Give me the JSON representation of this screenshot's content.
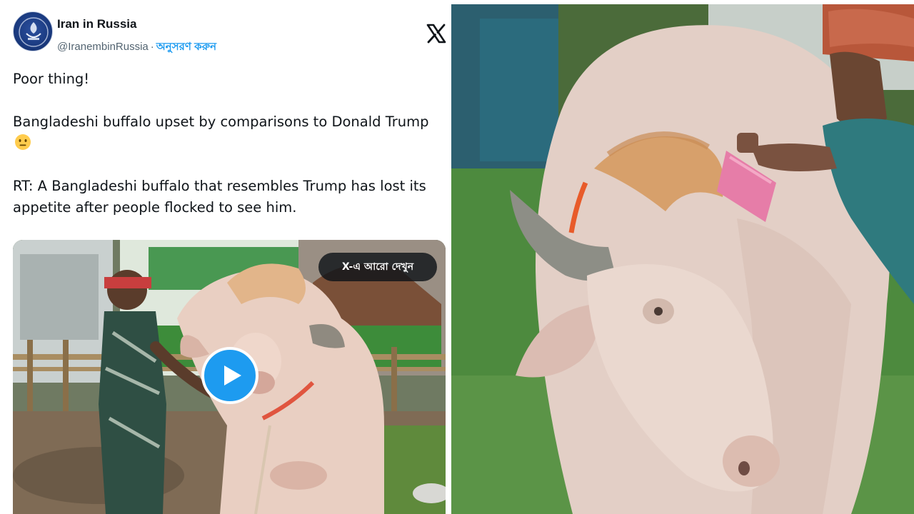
{
  "tweet": {
    "author": {
      "display_name": "Iran in Russia",
      "handle": "@IranembinRussia",
      "separator": "·",
      "follow_label": "অনুসরণ করুন"
    },
    "platform_icon": "x-logo-icon",
    "paragraphs": [
      "Poor thing!",
      "Bangladeshi buffalo upset by comparisons to Donald Trump",
      "RT: A Bangladeshi buffalo that resembles Trump has lost its appetite after people flocked to see him."
    ],
    "emoji": "neutral-face-emoji",
    "video": {
      "see_more_label": "X-এ আরো দেখুন",
      "play_icon": "play-icon"
    }
  },
  "colors": {
    "accent": "#1d9bf0",
    "text": "#0f1419",
    "muted": "#536471"
  }
}
